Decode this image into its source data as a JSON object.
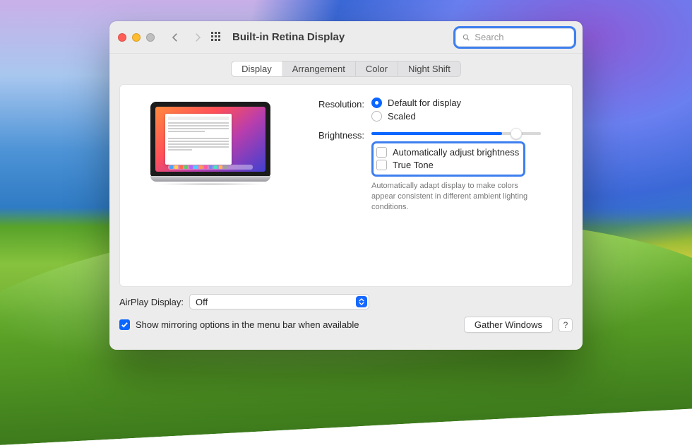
{
  "window": {
    "title": "Built-in Retina Display"
  },
  "search": {
    "placeholder": "Search"
  },
  "tabs": [
    {
      "label": "Display",
      "selected": true
    },
    {
      "label": "Arrangement"
    },
    {
      "label": "Color"
    },
    {
      "label": "Night Shift"
    }
  ],
  "resolution": {
    "label": "Resolution:",
    "options": [
      "Default for display",
      "Scaled"
    ],
    "selected": "Default for display"
  },
  "brightness": {
    "label": "Brightness:",
    "value_percent": 77,
    "auto_label": "Automatically adjust brightness",
    "auto_checked": false,
    "truetone_label": "True Tone",
    "truetone_checked": false,
    "truetone_help": "Automatically adapt display to make colors appear consistent in different ambient lighting conditions."
  },
  "airplay": {
    "label": "AirPlay Display:",
    "selected": "Off"
  },
  "mirroring": {
    "checked": true,
    "label": "Show mirroring options in the menu bar when available"
  },
  "buttons": {
    "gather": "Gather Windows",
    "help": "?"
  }
}
